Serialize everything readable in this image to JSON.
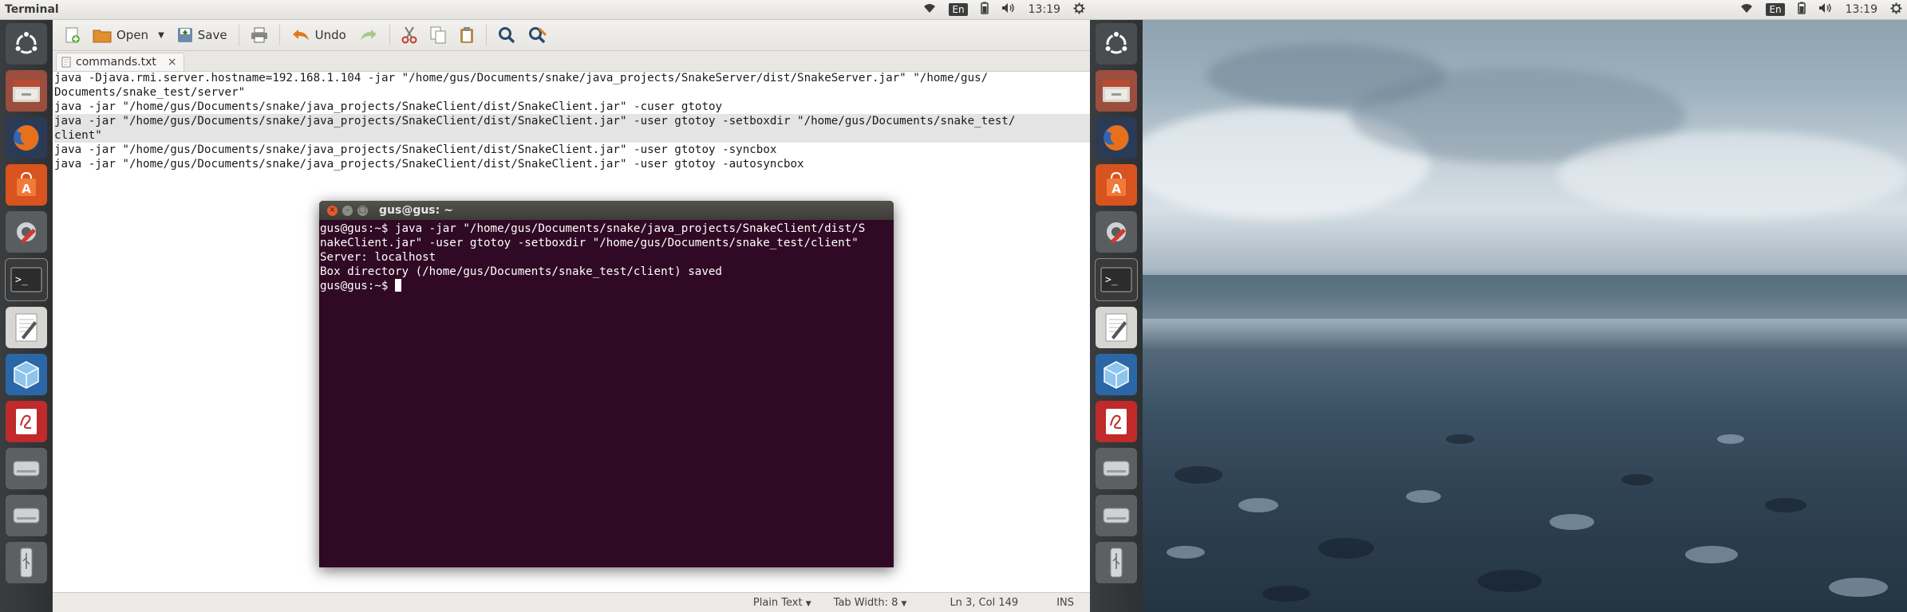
{
  "panel": {
    "title": "Terminal",
    "keyboard_layout": "En",
    "time": "13:19"
  },
  "gedit": {
    "toolbar": {
      "open_label": "Open",
      "save_label": "Save",
      "undo_label": "Undo"
    },
    "tab": {
      "label": "commands.txt",
      "close": "×"
    },
    "lines": [
      "java -Djava.rmi.server.hostname=192.168.1.104 -jar \"/home/gus/Documents/snake/java_projects/SnakeServer/dist/SnakeServer.jar\" \"/home/gus/",
      "Documents/snake_test/server\"",
      "java -jar \"/home/gus/Documents/snake/java_projects/SnakeClient/dist/SnakeClient.jar\" -cuser gtotoy",
      "java -jar \"/home/gus/Documents/snake/java_projects/SnakeClient/dist/SnakeClient.jar\" -user gtotoy -setboxdir \"/home/gus/Documents/snake_test/",
      "client\"",
      "java -jar \"/home/gus/Documents/snake/java_projects/SnakeClient/dist/SnakeClient.jar\" -user gtotoy -syncbox",
      "java -jar \"/home/gus/Documents/snake/java_projects/SnakeClient/dist/SnakeClient.jar\" -user gtotoy -autosyncbox"
    ],
    "status": {
      "language": "Plain Text",
      "tab_width": "Tab Width: 8",
      "position": "Ln 3, Col 149",
      "mode": "INS"
    }
  },
  "terminal": {
    "title": "gus@gus: ~",
    "lines": [
      "gus@gus:~$ java -jar \"/home/gus/Documents/snake/java_projects/SnakeClient/dist/S",
      "nakeClient.jar\" -user gtotoy -setboxdir \"/home/gus/Documents/snake_test/client\"",
      "Server: localhost",
      "Box directory (/home/gus/Documents/snake_test/client) saved"
    ],
    "prompt": "gus@gus:~$ "
  },
  "colors": {
    "terminal_bg": "#300a24",
    "launcher_bg": "#2e3133",
    "accent_orange": "#e65a2e"
  },
  "launcher_icons": [
    "ubuntu-dash-icon",
    "files-icon",
    "firefox-icon",
    "software-center-icon",
    "system-settings-icon",
    "terminal-icon",
    "text-editor-icon",
    "virtualbox-icon",
    "document-viewer-icon",
    "drive-icon",
    "drive-icon",
    "usb-drive-icon"
  ]
}
